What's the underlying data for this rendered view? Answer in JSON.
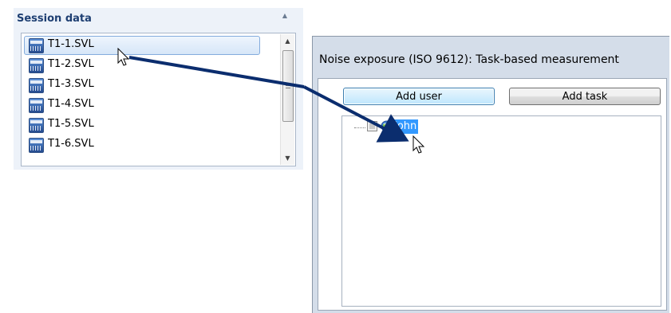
{
  "session_panel": {
    "title": "Session data",
    "files": [
      {
        "label": "T1-1.SVL",
        "selected": true
      },
      {
        "label": "T1-2.SVL",
        "selected": false
      },
      {
        "label": "T1-3.SVL",
        "selected": false
      },
      {
        "label": "T1-4.SVL",
        "selected": false
      },
      {
        "label": "T1-5.SVL",
        "selected": false
      },
      {
        "label": "T1-6.SVL",
        "selected": false
      }
    ],
    "file_icon": "svl-file-icon"
  },
  "noise_window": {
    "title": "Noise exposure (ISO 9612): Task-based measurement",
    "add_user_label": "Add user",
    "add_task_label": "Add task",
    "tree": {
      "user_label": "John",
      "user_icon": "globe-user-icon"
    }
  },
  "overlay": {
    "arrow_color": "#0b2d6e",
    "selection_color": "#3399ff",
    "description_icons": [
      "arrow-cursor-icon",
      "drag-arrow"
    ]
  }
}
